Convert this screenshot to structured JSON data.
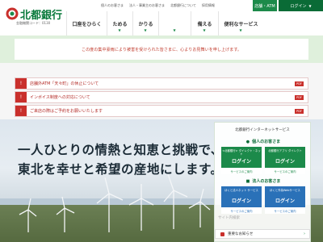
{
  "header": {
    "logo_text": "北都銀行",
    "logo_sub": "金融機関コード：0130",
    "top_links": [
      "個人のお客さま",
      "法人・事業主のお客さま",
      "北都銀行について",
      "採用情報"
    ],
    "store_button": "店舗・ATM",
    "login_button": "ログイン"
  },
  "nav": {
    "items": [
      {
        "label": "口座をひらく"
      },
      {
        "label": "ためる"
      },
      {
        "label": "かりる"
      },
      {
        "label": "備える"
      },
      {
        "label": "便利なサービス"
      }
    ]
  },
  "notice": {
    "text": "この度の集中豪雨により被害を受けられた皆さまに、心よりお見舞いを申し上げます。"
  },
  "alerts": [
    {
      "text": "店舗外ATM「天々町」の休止について",
      "badge": "PDF"
    },
    {
      "text": "インボイス制度への対応について",
      "badge": "PDF"
    },
    {
      "text": "ご来店の際はご予約をお願いいたします",
      "badge": "PDF"
    }
  ],
  "hero": {
    "line1": "一人ひとりの情熱と知恵と挑戦で、",
    "line2": "東北を幸せと希望の産地にします。"
  },
  "panel": {
    "title": "北都銀行インターネットサービス",
    "personal_label": "個人のお客さま",
    "business_label": "法人のお客さま",
    "boxes": [
      {
        "caption": "<北都銀行>\nダイレクト・ネット",
        "label": "ログイン",
        "link": "サービスのご案内"
      },
      {
        "caption": "北都銀行アプリ\nダイレクト",
        "label": "ログイン",
        "link": "サービスのご案内"
      },
      {
        "caption": "ほくと法人ネット\nサービス",
        "label": "ログイン",
        "link": "サービスのご案内"
      },
      {
        "caption": "ほくと外為Webサービス",
        "label": "ログイン",
        "link": "サービスのご案内"
      }
    ],
    "search_placeholder": "サイト内検索",
    "app_button": "重要なお知らせ"
  },
  "colors": {
    "brand_green": "#1c8a4a",
    "dark_green": "#0a6b36",
    "alert_red": "#c9302c",
    "notice_bg": "#dff0dc",
    "business_blue": "#2a71b8"
  }
}
